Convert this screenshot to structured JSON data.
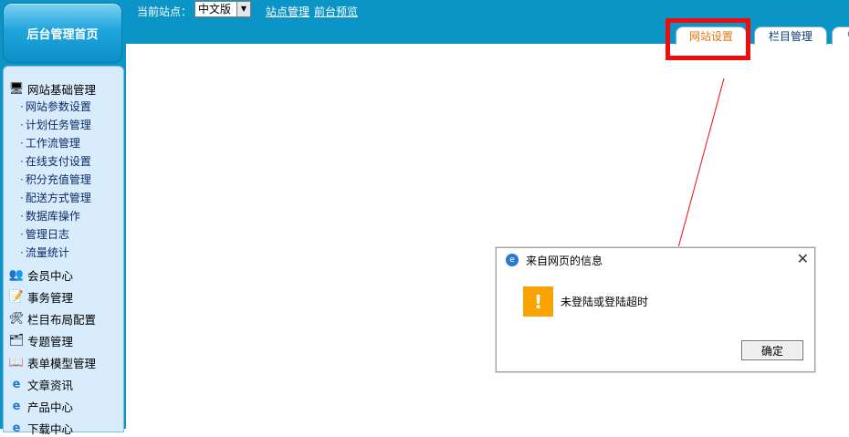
{
  "sidebar": {
    "home_label": "后台管理首页",
    "groups": [
      {
        "title": "网站基础管理",
        "icon": "computer-icon",
        "items": [
          "网站参数设置",
          "计划任务管理",
          "工作流管理",
          "在线支付设置",
          "积分充值管理",
          "配送方式管理",
          "数据库操作",
          "管理日志",
          "流量统计"
        ]
      }
    ],
    "sections": [
      {
        "title": "会员中心",
        "icon": "users-icon"
      },
      {
        "title": "事务管理",
        "icon": "notepad-icon"
      },
      {
        "title": "栏目布局配置",
        "icon": "tools-icon"
      },
      {
        "title": "专题管理",
        "icon": "tree-icon"
      },
      {
        "title": "表单模型管理",
        "icon": "book-icon"
      },
      {
        "title": "文章资讯",
        "icon": "ie-icon"
      },
      {
        "title": "产品中心",
        "icon": "ie-icon"
      },
      {
        "title": "下载中心",
        "icon": "ie-icon"
      }
    ],
    "item_dot": "·"
  },
  "topbar": {
    "site_label": "当前站点：",
    "site_select_value": "中文版",
    "links": [
      "站点管理",
      "前台预览"
    ]
  },
  "tabs": [
    {
      "label": "网站设置",
      "active": true
    },
    {
      "label": "栏目管理",
      "active": false
    },
    {
      "label": "管",
      "active": false
    }
  ],
  "dialog": {
    "title": "来自网页的信息",
    "message": "未登陆或登陆超时",
    "ok_label": "确定",
    "warn_glyph": "!",
    "close_glyph": "✕"
  },
  "colors": {
    "brand": "#0b94c6",
    "annotation": "#ef0c0c",
    "warning": "#f8a300",
    "active_tab": "#e3760c"
  }
}
